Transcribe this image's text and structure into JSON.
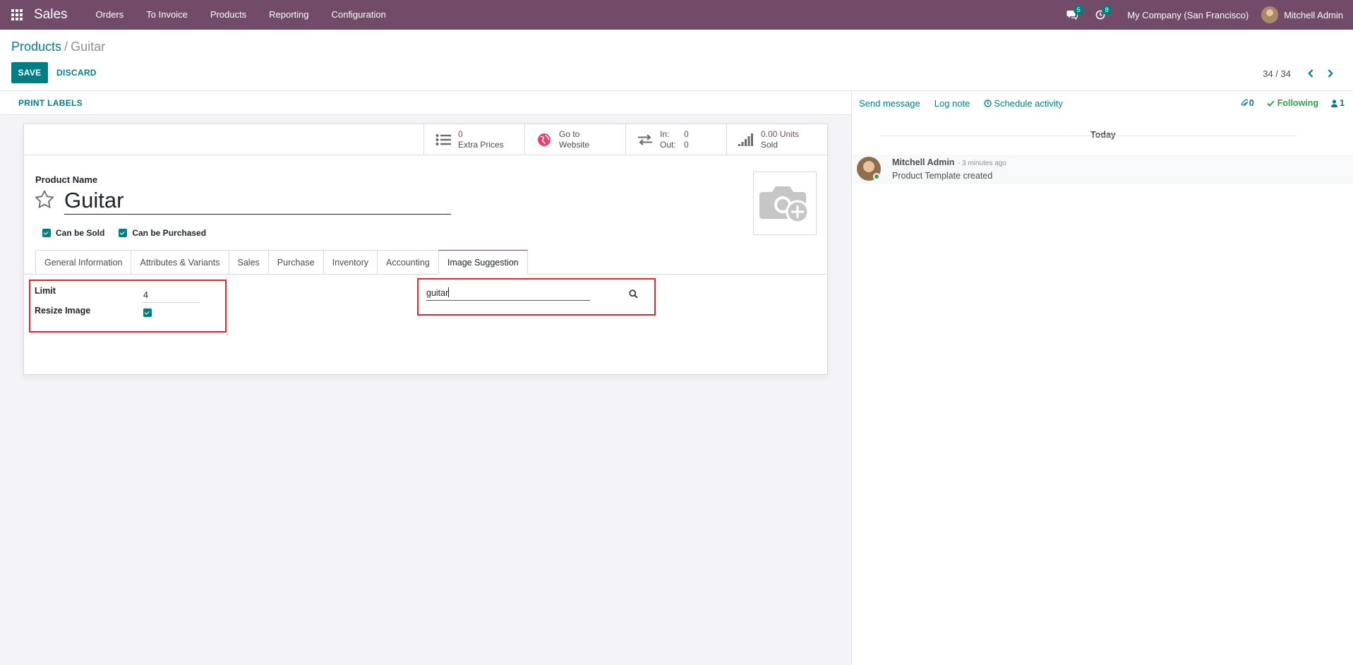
{
  "topbar": {
    "app_name": "Sales",
    "menu": [
      "Orders",
      "To Invoice",
      "Products",
      "Reporting",
      "Configuration"
    ],
    "messages_count": "5",
    "activities_count": "8",
    "company": "My Company (San Francisco)",
    "user": "Mitchell Admin"
  },
  "control": {
    "breadcrumb_parent": "Products",
    "breadcrumb_sep": "/",
    "breadcrumb_current": "Guitar",
    "save_label": "SAVE",
    "discard_label": "DISCARD",
    "pager": "34 / 34"
  },
  "statusbar": {
    "print_labels": "PRINT LABELS"
  },
  "smart_buttons": {
    "extra_prices_value": "0",
    "extra_prices_label": "Extra Prices",
    "website_line1": "Go to",
    "website_line2": "Website",
    "in_label": "In:",
    "in_value": "0",
    "out_label": "Out:",
    "out_value": "0",
    "sold_value": "0.00 Units",
    "sold_label": "Sold"
  },
  "form": {
    "product_name_label": "Product Name",
    "product_name": "Guitar",
    "can_be_sold": "Can be Sold",
    "can_be_purchased": "Can be Purchased",
    "tabs": [
      "General Information",
      "Attributes & Variants",
      "Sales",
      "Purchase",
      "Inventory",
      "Accounting",
      "Image Suggestion"
    ],
    "limit_label": "Limit",
    "limit_value": "4",
    "resize_label": "Resize Image",
    "search_value": "guitar"
  },
  "chatter": {
    "send_message": "Send message",
    "log_note": "Log note",
    "schedule_activity": "Schedule activity",
    "attachments": "0",
    "following": "Following",
    "followers": "1",
    "today": "Today",
    "author": "Mitchell Admin",
    "time": "- 3 minutes ago",
    "body": "Product Template created"
  },
  "colors": {
    "brand": "#714b67",
    "accent": "#017e84",
    "highlight_red": "#e32626",
    "following_green": "#28a745"
  }
}
